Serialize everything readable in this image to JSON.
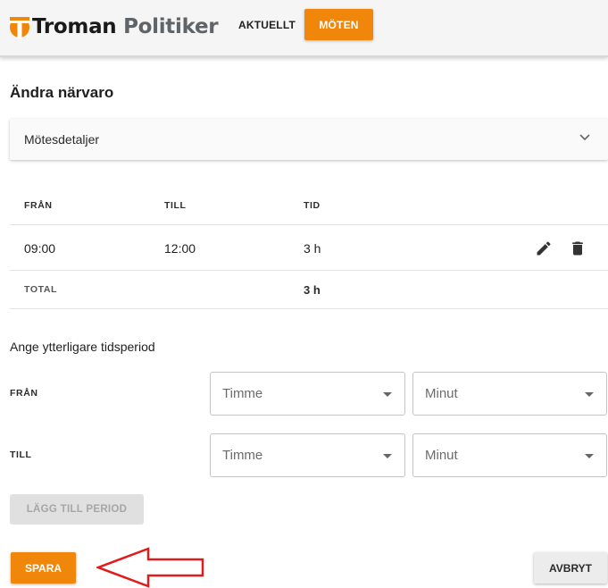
{
  "header": {
    "logo_brand": "Troman",
    "logo_rest": " Politiker",
    "nav": [
      {
        "label": "AKTUELLT",
        "active": false
      },
      {
        "label": "MÖTEN",
        "active": true
      }
    ]
  },
  "page_title": "Ändra närvaro",
  "accordion": {
    "label": "Mötesdetaljer",
    "icon": "chevron-down-icon"
  },
  "table": {
    "headers": [
      "FRÅN",
      "TILL",
      "TID"
    ],
    "rows": [
      {
        "from": "09:00",
        "to": "12:00",
        "duration": "3 h"
      }
    ],
    "total_label": "TOTAL",
    "total_value": "3 h",
    "row_icons": [
      "edit-icon",
      "delete-icon"
    ]
  },
  "add_period": {
    "title": "Ange ytterligare tidsperiod",
    "from_label": "FRÅN",
    "to_label": "TILL",
    "hour_placeholder": "Timme",
    "minute_placeholder": "Minut",
    "add_button": "LÄGG TILL PERIOD"
  },
  "actions": {
    "save": "SPARA",
    "cancel": "AVBRYT"
  },
  "colors": {
    "accent": "#f0870a",
    "arrow": "#e01b1b"
  }
}
